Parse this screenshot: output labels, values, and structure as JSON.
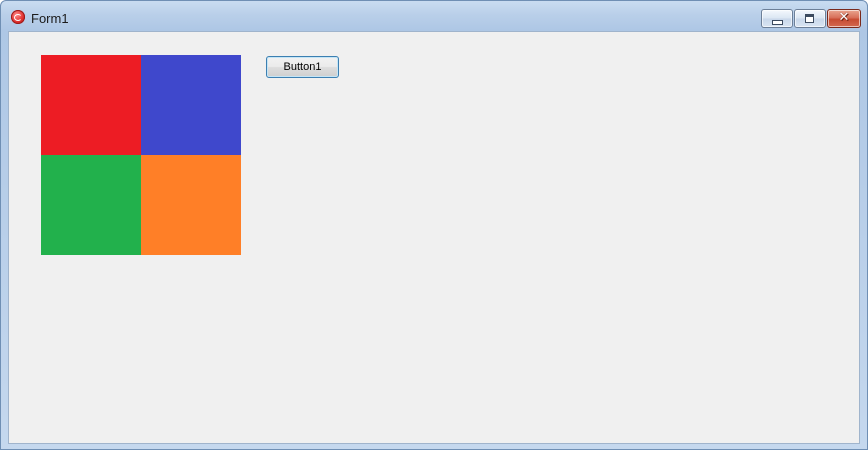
{
  "window": {
    "title": "Form1"
  },
  "titlebar": {
    "icons": {
      "app": "app-icon",
      "minimize": "minimize-icon",
      "maximize": "maximize-icon",
      "close": "close-icon"
    }
  },
  "form": {
    "button1_label": "Button1",
    "color_grid": {
      "top_left": "#ed1c24",
      "top_right": "#3f48cc",
      "bottom_left": "#22b14c",
      "bottom_right": "#ff7f27"
    }
  }
}
